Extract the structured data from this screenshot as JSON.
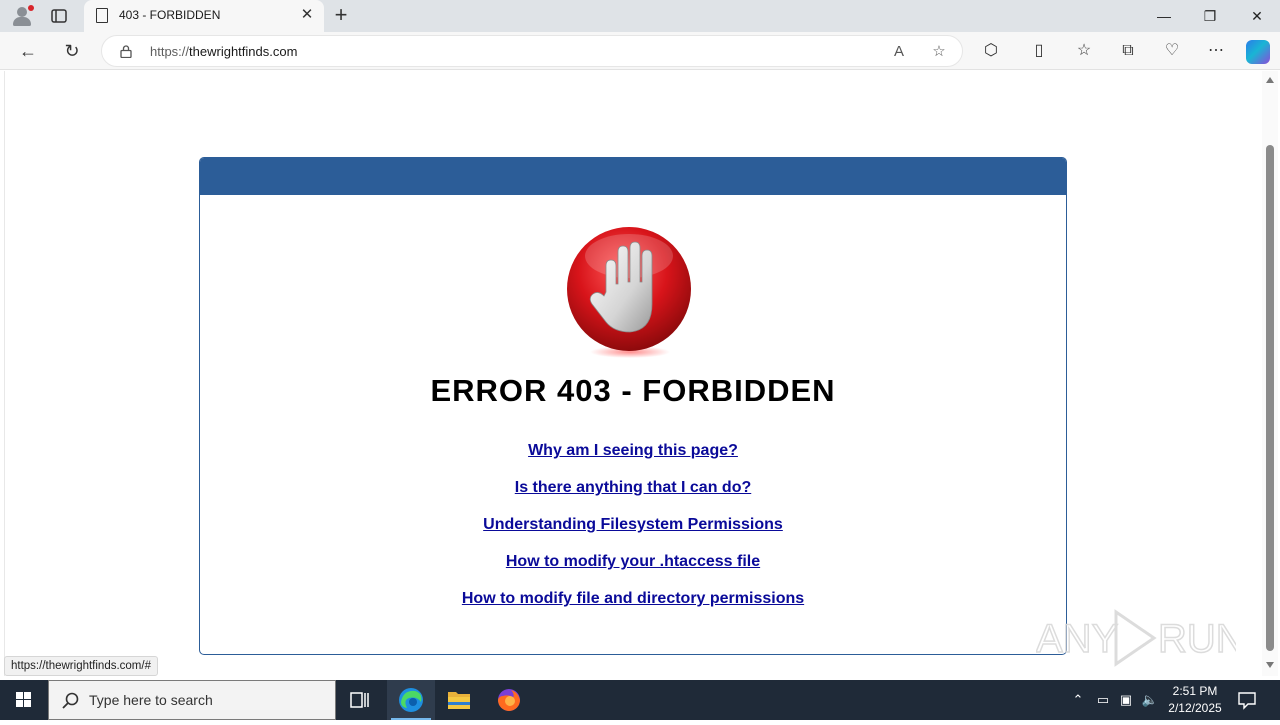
{
  "browser": {
    "tab_title": "403 - FORBIDDEN",
    "url_prefix": "https://",
    "url_host": "thewrightfinds.com",
    "status_url": "https://thewrightfinds.com/#"
  },
  "page": {
    "heading": "ERROR 403 - FORBIDDEN",
    "links": [
      "Why am I seeing this page?",
      "Is there anything that I can do?",
      "Understanding Filesystem Permissions",
      "How to modify your .htaccess file",
      "How to modify file and directory permissions"
    ],
    "header_color": "#2c5d98",
    "link_color": "#0a0a99"
  },
  "taskbar": {
    "search_placeholder": "Type here to search",
    "time": "2:51 PM",
    "date": "2/12/2025"
  },
  "watermark": "ANY RUN"
}
